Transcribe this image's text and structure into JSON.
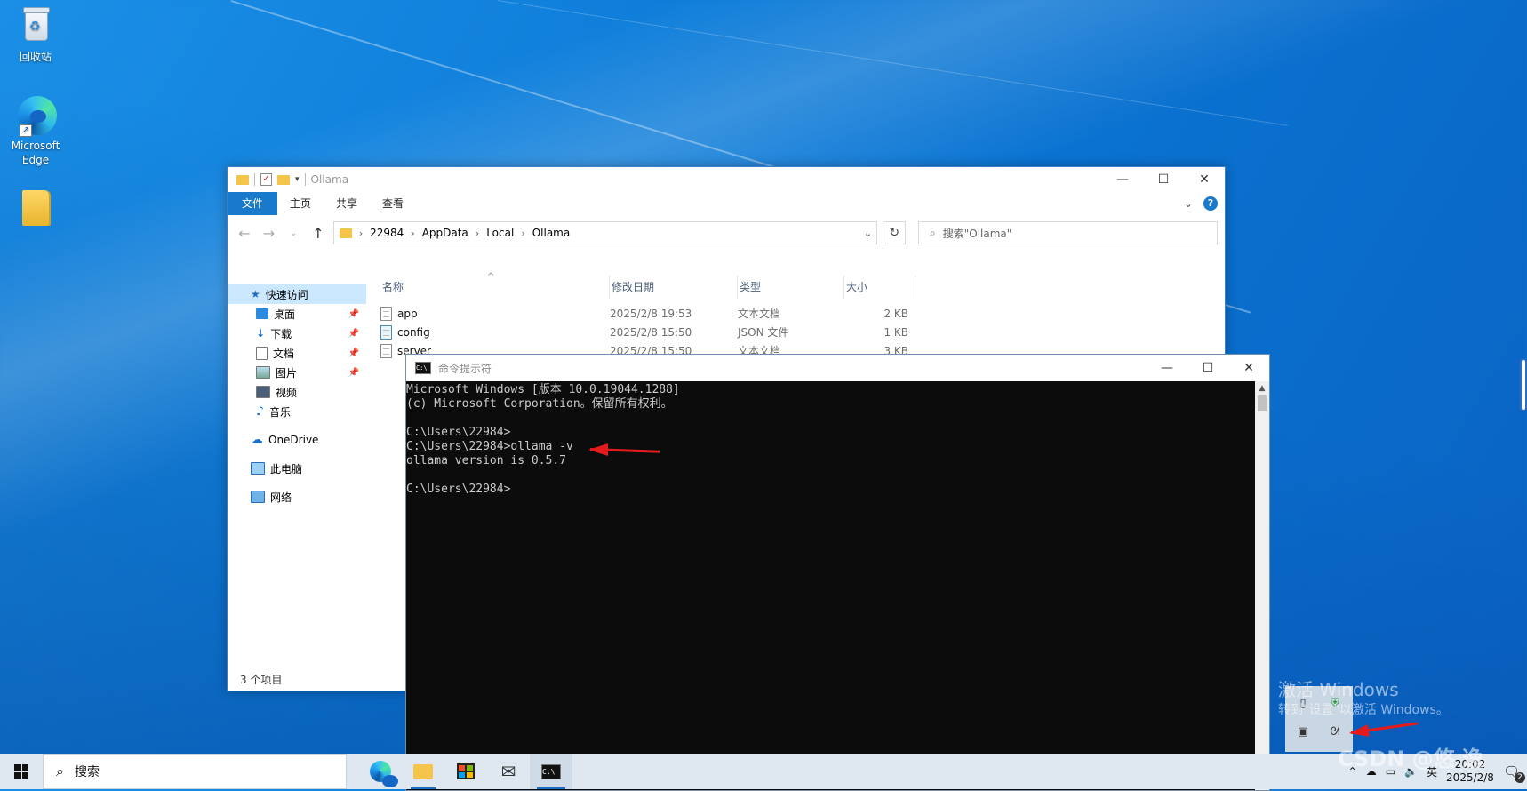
{
  "desktop": {
    "icons": [
      {
        "label": "回收站"
      },
      {
        "label": "Microsoft Edge"
      },
      {
        "label": ""
      }
    ]
  },
  "explorer": {
    "title": "Ollama",
    "ribbon_tabs": [
      "文件",
      "主页",
      "共享",
      "查看"
    ],
    "breadcrumb": [
      "22984",
      "AppData",
      "Local",
      "Ollama"
    ],
    "search_placeholder": "搜索\"Ollama\"",
    "nav": {
      "quick_access": "快速访问",
      "items": [
        "桌面",
        "下载",
        "文档",
        "图片",
        "视频",
        "音乐"
      ],
      "onedrive": "OneDrive",
      "this_pc": "此电脑",
      "network": "网络"
    },
    "columns": [
      "名称",
      "修改日期",
      "类型",
      "大小"
    ],
    "files": [
      {
        "name": "app",
        "date": "2025/2/8 19:53",
        "type": "文本文档",
        "size": "2 KB",
        "icon": "text-file-icon"
      },
      {
        "name": "config",
        "date": "2025/2/8 15:50",
        "type": "JSON 文件",
        "size": "1 KB",
        "icon": "json-file-icon"
      },
      {
        "name": "server",
        "date": "2025/2/8 15:50",
        "type": "文本文档",
        "size": "3 KB",
        "icon": "text-file-icon"
      }
    ],
    "status": "3 个项目"
  },
  "cmd": {
    "title": "命令提示符",
    "lines": [
      "Microsoft Windows [版本 10.0.19044.1288]",
      "(c) Microsoft Corporation。保留所有权利。",
      "",
      "C:\\Users\\22984>",
      "C:\\Users\\22984>ollama -v",
      "ollama version is 0.5.7",
      "",
      "C:\\Users\\22984>"
    ]
  },
  "watermark": {
    "line1": "激活 Windows",
    "line2": "转到\"设置\"以激活 Windows。",
    "csdn": "CSDN @悠 逸"
  },
  "taskbar": {
    "search_placeholder": "搜索",
    "ime": "英",
    "time": "20:02",
    "date": "2025/2/8",
    "notification_count": "2"
  },
  "colors": {
    "accent": "#1979ca",
    "annotation_arrow": "#e51b1b",
    "console_bg": "#0c0c0c",
    "console_text": "#cccccc"
  }
}
